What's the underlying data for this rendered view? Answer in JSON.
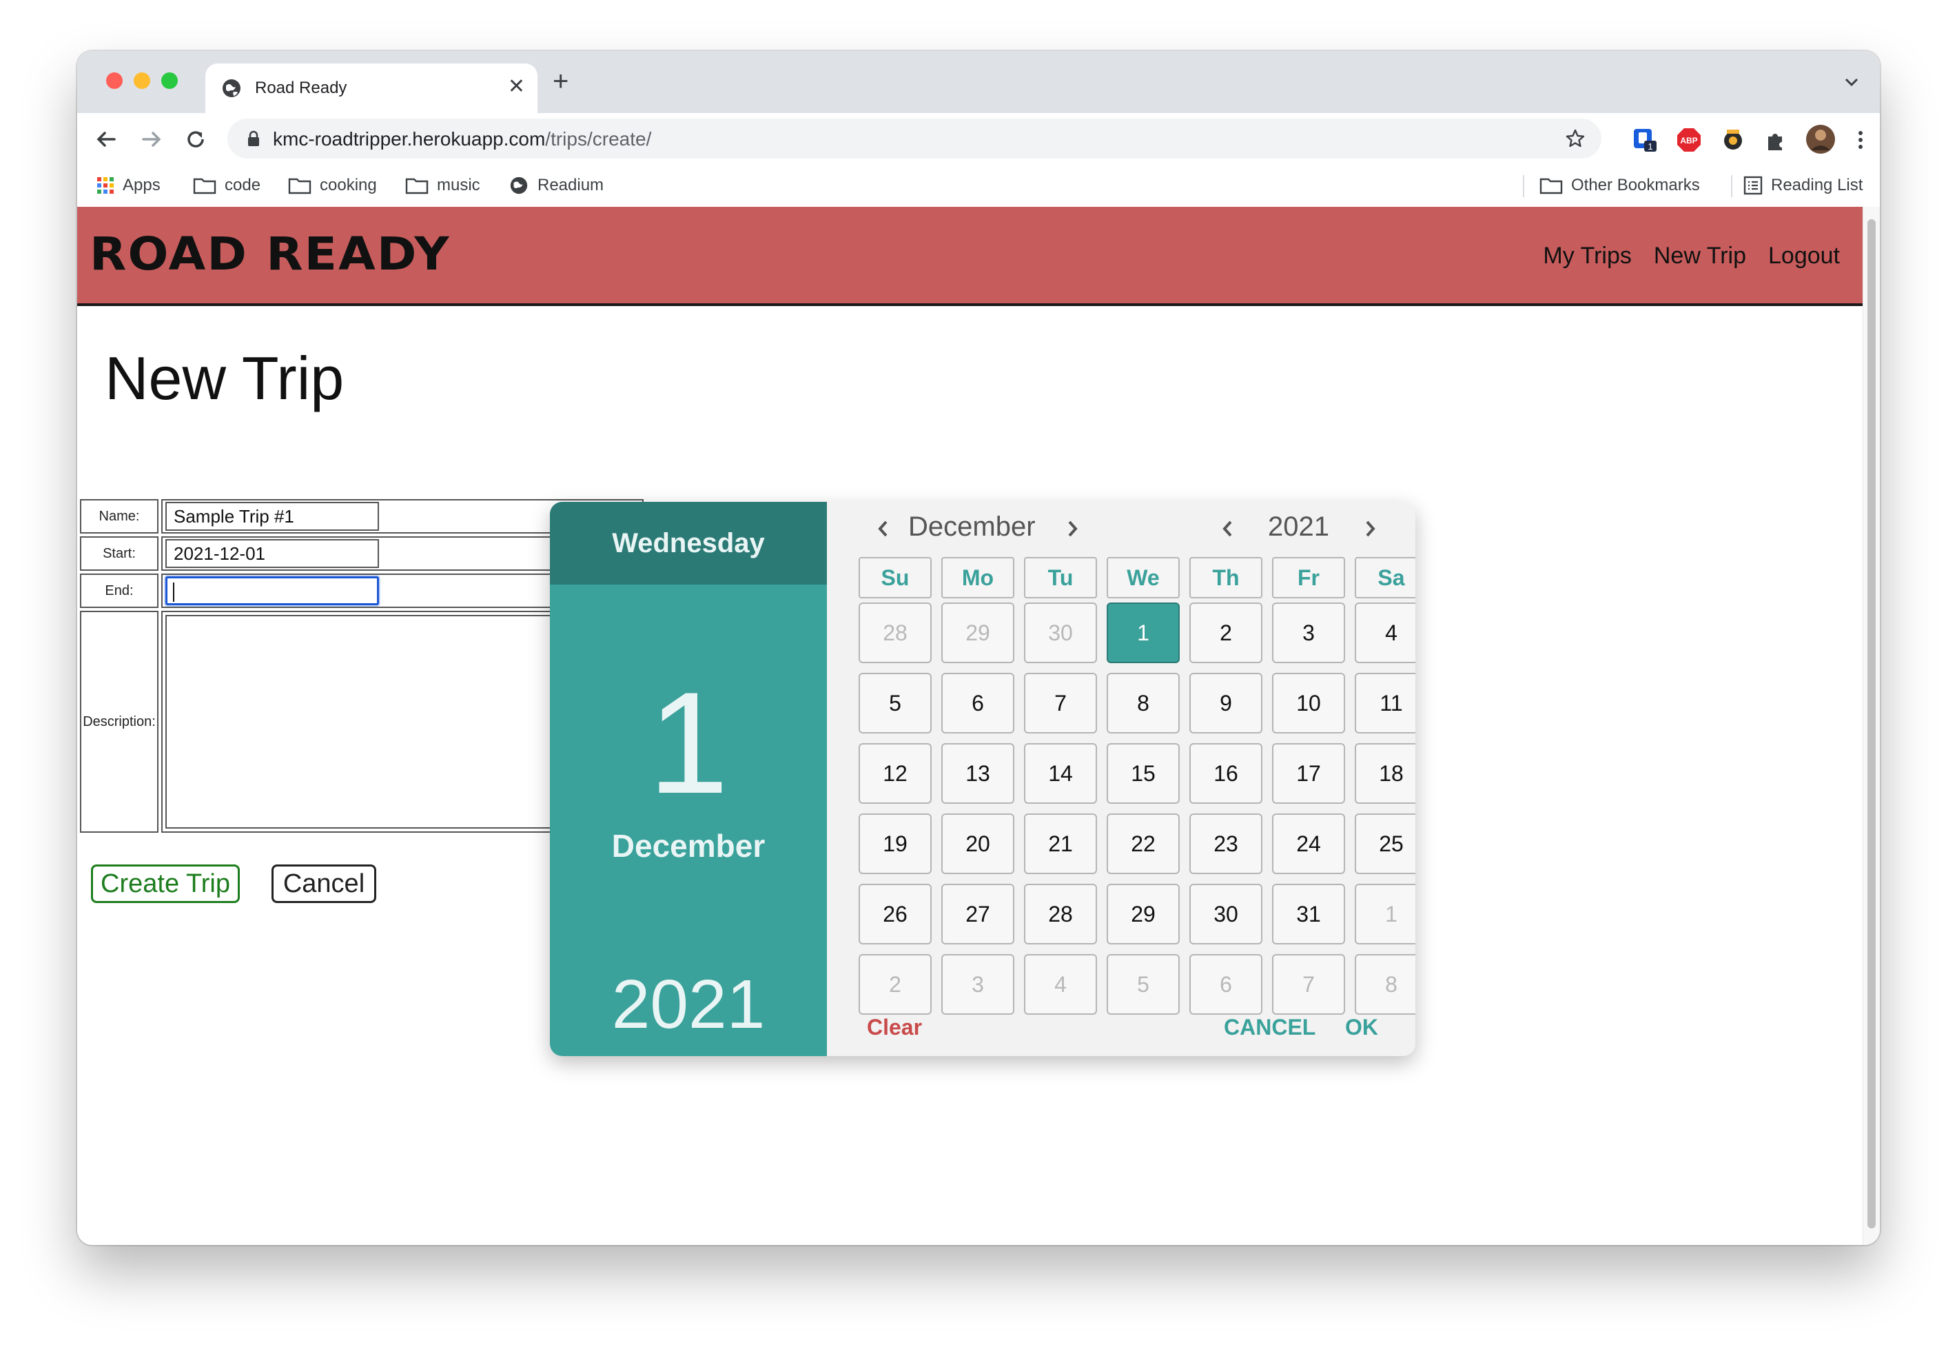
{
  "browser": {
    "tab_title": "Road Ready",
    "url_host": "kmc-roadtripper.herokuapp.com",
    "url_path": "/trips/create/",
    "extension_badge": "1",
    "bookmarks": [
      {
        "label": "Apps",
        "icon": "apps-grid-icon"
      },
      {
        "label": "code",
        "icon": "folder-icon"
      },
      {
        "label": "cooking",
        "icon": "folder-icon"
      },
      {
        "label": "music",
        "icon": "folder-icon"
      },
      {
        "label": "Readium",
        "icon": "globe-icon"
      }
    ],
    "other_bookmarks": "Other Bookmarks",
    "reading_list": "Reading List"
  },
  "site": {
    "brand": "ROAD READY",
    "nav": [
      "My Trips",
      "New Trip",
      "Logout"
    ],
    "header_color": "#c75c5c"
  },
  "page": {
    "title": "New Trip",
    "form": {
      "name_label": "Name:",
      "name_value": "Sample Trip #1",
      "start_label": "Start:",
      "start_value": "2021-12-01",
      "end_label": "End:",
      "end_value": "",
      "description_label": "Description:"
    },
    "create_button": "Create Trip",
    "cancel_button": "Cancel"
  },
  "datepicker": {
    "accent": "#3aa19b",
    "weekday": "Wednesday",
    "day": "1",
    "month_name": "December",
    "year": "2021",
    "nav_month": "December",
    "nav_year": "2021",
    "day_headers": [
      "Su",
      "Mo",
      "Tu",
      "We",
      "Th",
      "Fr",
      "Sa"
    ],
    "weeks": [
      [
        {
          "d": "28",
          "m": true
        },
        {
          "d": "29",
          "m": true
        },
        {
          "d": "30",
          "m": true
        },
        {
          "d": "1",
          "s": true
        },
        {
          "d": "2"
        },
        {
          "d": "3"
        },
        {
          "d": "4"
        }
      ],
      [
        {
          "d": "5"
        },
        {
          "d": "6"
        },
        {
          "d": "7"
        },
        {
          "d": "8"
        },
        {
          "d": "9"
        },
        {
          "d": "10"
        },
        {
          "d": "11"
        }
      ],
      [
        {
          "d": "12"
        },
        {
          "d": "13"
        },
        {
          "d": "14"
        },
        {
          "d": "15"
        },
        {
          "d": "16"
        },
        {
          "d": "17"
        },
        {
          "d": "18"
        }
      ],
      [
        {
          "d": "19"
        },
        {
          "d": "20"
        },
        {
          "d": "21"
        },
        {
          "d": "22"
        },
        {
          "d": "23"
        },
        {
          "d": "24"
        },
        {
          "d": "25"
        }
      ],
      [
        {
          "d": "26"
        },
        {
          "d": "27"
        },
        {
          "d": "28"
        },
        {
          "d": "29"
        },
        {
          "d": "30"
        },
        {
          "d": "31"
        },
        {
          "d": "1",
          "m": true
        }
      ],
      [
        {
          "d": "2",
          "m": true
        },
        {
          "d": "3",
          "m": true
        },
        {
          "d": "4",
          "m": true
        },
        {
          "d": "5",
          "m": true
        },
        {
          "d": "6",
          "m": true
        },
        {
          "d": "7",
          "m": true
        },
        {
          "d": "8",
          "m": true
        }
      ]
    ],
    "clear_label": "Clear",
    "cancel_label": "CANCEL",
    "ok_label": "OK"
  }
}
